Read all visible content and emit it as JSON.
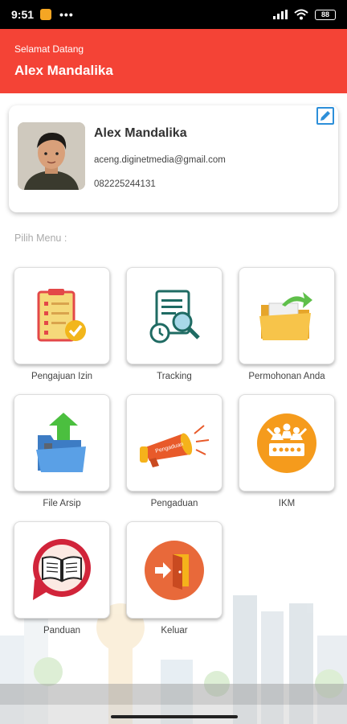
{
  "status_bar": {
    "time": "9:51",
    "dots": "•••",
    "battery": "88"
  },
  "header": {
    "greeting": "Selamat Datang",
    "user_name": "Alex Mandalika"
  },
  "profile": {
    "name": "Alex Mandalika",
    "email": "aceng.diginetmedia@gmail.com",
    "phone": "082225244131"
  },
  "menu_title": "Pilih Menu :",
  "menu": [
    {
      "label": "Pengajuan Izin",
      "icon": "clipboard-checklist-icon"
    },
    {
      "label": "Tracking",
      "icon": "document-search-icon"
    },
    {
      "label": "Permohonan Anda",
      "icon": "folder-share-icon"
    },
    {
      "label": "File Arsip",
      "icon": "folder-upload-icon"
    },
    {
      "label": "Pengaduan",
      "icon": "megaphone-icon"
    },
    {
      "label": "IKM",
      "icon": "ikm-rating-icon"
    },
    {
      "label": "Panduan",
      "icon": "book-guide-icon"
    },
    {
      "label": "Keluar",
      "icon": "exit-door-icon"
    }
  ],
  "megaphone_text": "Pengaduan",
  "colors": {
    "header": "#f44336",
    "accent_blue": "#2d8fd9",
    "ikm_orange": "#f59b1c",
    "exit_orange": "#e8693a"
  }
}
